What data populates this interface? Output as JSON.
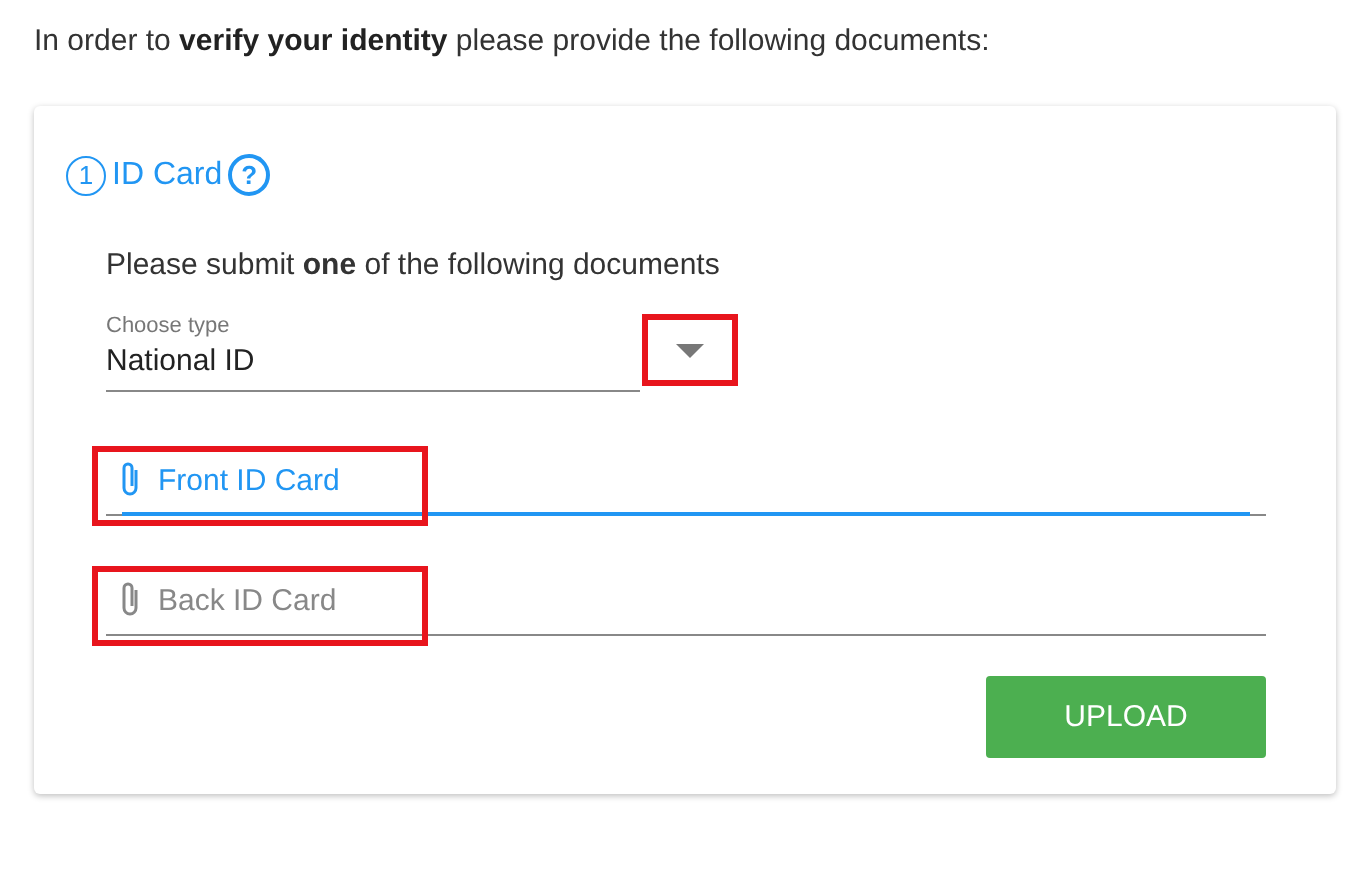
{
  "intro": "In order to **verify your identity** please provide the following documents:",
  "card": {
    "step": "1",
    "title": "ID Card",
    "help": "?",
    "instruction": "Please submit **one** of the following documents",
    "select": {
      "label": "Choose type",
      "value": "National ID",
      "highlighted": true
    },
    "files": [
      {
        "label": "Front ID Card",
        "focused": true,
        "highlighted": true
      },
      {
        "label": "Back ID Card",
        "focused": false,
        "highlighted": true
      }
    ],
    "button": "UPLOAD"
  }
}
